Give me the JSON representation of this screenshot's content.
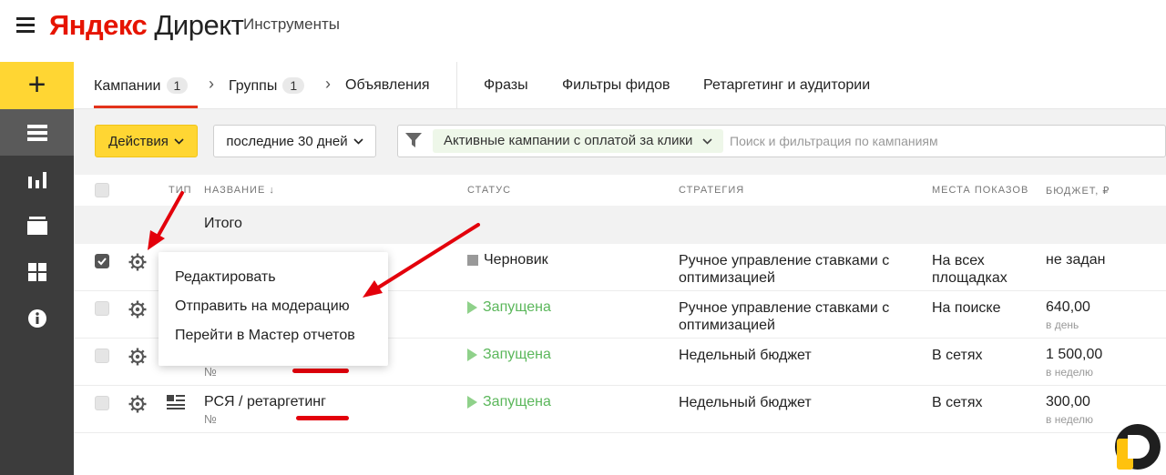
{
  "header": {
    "logo_ya": "Яндекс",
    "logo_direct": "Директ",
    "tools_link": "Инструменты"
  },
  "nav": {
    "campaigns": {
      "label": "Кампании",
      "count": "1"
    },
    "groups": {
      "label": "Группы",
      "count": "1"
    },
    "ads": "Объявления",
    "phrases": "Фразы",
    "feed_filters": "Фильтры фидов",
    "retargeting": "Ретаргетинг и аудитории"
  },
  "toolbar": {
    "actions_label": "Действия",
    "period_label": "последние 30 дней",
    "filter_chip": "Активные кампании с оплатой за клики",
    "search_placeholder": "Поиск и фильтрация по кампаниям"
  },
  "table": {
    "columns": {
      "type": "ТИП",
      "name": "НАЗВАНИЕ ↓",
      "status": "СТАТУС",
      "strategy": "СТРАТЕГИЯ",
      "placements": "МЕСТА ПОКАЗОВ",
      "budget": "БЮДЖЕТ, ₽"
    },
    "total_label": "Итого",
    "rows": [
      {
        "name": "",
        "number": "",
        "status": "Черновик",
        "strategy": "Ручное управление ставками с оптимизацией",
        "placements": "На всех площадках",
        "budget": "не задан",
        "budget_period": ""
      },
      {
        "name": "",
        "number": "",
        "status": "Запущена",
        "strategy": "Ручное управление ставками с оптимизацией",
        "placements": "На поиске",
        "budget": "640,00",
        "budget_period": "в день"
      },
      {
        "name": "",
        "number": "№",
        "status": "Запущена",
        "strategy": "Недельный бюджет",
        "placements": "В сетях",
        "budget": "1 500,00",
        "budget_period": "в неделю"
      },
      {
        "name": "РСЯ / ретаргетинг",
        "number": "№",
        "status": "Запущена",
        "strategy": "Недельный бюджет",
        "placements": "В сетях",
        "budget": "300,00",
        "budget_period": "в неделю"
      }
    ]
  },
  "context_menu": {
    "items": [
      "Редактировать",
      "Отправить на модерацию",
      "Перейти в Мастер отчетов"
    ]
  },
  "colors": {
    "accent_yellow": "#ffd633",
    "tab_red": "#e3321b",
    "running_green": "#5bb75b",
    "annotation_red": "#e3000b"
  }
}
